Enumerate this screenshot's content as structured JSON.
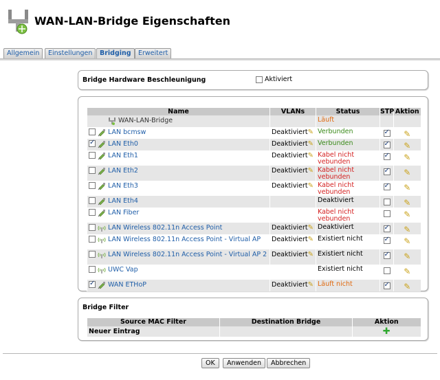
{
  "window": {
    "title": "WAN-LAN-Bridge Eigenschaften",
    "icon": "network-bridge-icon"
  },
  "tabs": [
    {
      "label": "Allgemein",
      "active": false
    },
    {
      "label": "Einstellungen",
      "active": false
    },
    {
      "label": "Bridging",
      "active": true
    },
    {
      "label": "Erweitert",
      "active": false
    }
  ],
  "hw_panel": {
    "title": "Bridge Hardware Beschleunigung",
    "checkbox_label": "Aktiviert",
    "checked": false
  },
  "table": {
    "headers": {
      "name": "Name",
      "vlans": "VLANs",
      "status": "Status",
      "stp": "STP",
      "action": "Aktion"
    },
    "bridge": {
      "name": "WAN-LAN-Bridge",
      "status": "Läuft"
    },
    "rows": [
      {
        "name": "LAN bcmsw",
        "icon": "ethernet-icon",
        "selected": false,
        "vlan": "Deaktiviert",
        "status": "Verbunden",
        "status_color": "green",
        "stp": true
      },
      {
        "name": "LAN Eth0",
        "icon": "ethernet-icon",
        "selected": true,
        "vlan": "Deaktiviert",
        "status": "Verbunden",
        "status_color": "green",
        "stp": true
      },
      {
        "name": "LAN Eth1",
        "icon": "ethernet-icon",
        "selected": false,
        "vlan": "Deaktiviert",
        "status": "Kabel nicht vebunden",
        "status_color": "red",
        "stp": true
      },
      {
        "name": "LAN Eth2",
        "icon": "ethernet-icon",
        "selected": false,
        "vlan": "Deaktiviert",
        "status": "Kabel nicht vebunden",
        "status_color": "red",
        "stp": true
      },
      {
        "name": "LAN Eth3",
        "icon": "ethernet-icon",
        "selected": false,
        "vlan": "Deaktiviert",
        "status": "Kabel nicht vebunden",
        "status_color": "red",
        "stp": true
      },
      {
        "name": "LAN Eth4",
        "icon": "ethernet-icon",
        "selected": false,
        "vlan": "",
        "status": "Deaktiviert",
        "status_color": "black",
        "stp": false
      },
      {
        "name": "LAN Fiber",
        "icon": "ethernet-icon",
        "selected": false,
        "vlan": "",
        "status": "Kabel nicht vebunden",
        "status_color": "red",
        "stp": false
      },
      {
        "name": "LAN Wireless 802.11n Access Point",
        "icon": "wireless-icon",
        "selected": false,
        "vlan": "Deaktiviert",
        "status": "Deaktiviert",
        "status_color": "black",
        "stp": true
      },
      {
        "name": "LAN Wireless 802.11n Access Point - Virtual AP",
        "icon": "wireless-icon",
        "selected": false,
        "vlan": "Deaktiviert",
        "status": "Existiert nicht",
        "status_color": "black",
        "stp": true
      },
      {
        "name": "LAN Wireless 802.11n Access Point - Virtual AP 2",
        "icon": "wireless-icon",
        "selected": false,
        "vlan": "Deaktiviert",
        "status": "Existiert nicht",
        "status_color": "black",
        "stp": true
      },
      {
        "name": "UWC Vap",
        "icon": "wireless-icon",
        "selected": false,
        "vlan": "",
        "status": "Existiert nicht",
        "status_color": "black",
        "stp": false
      },
      {
        "name": "WAN ETHoP",
        "icon": "ethernet-icon",
        "selected": true,
        "vlan": "Deaktiviert",
        "status": "Läuft nicht",
        "status_color": "orange",
        "stp": true
      }
    ]
  },
  "filter_panel": {
    "title": "Bridge Filter",
    "headers": {
      "source": "Source MAC Filter",
      "destination": "Destination Bridge",
      "action": "Aktion"
    },
    "new_entry": "Neuer Eintrag"
  },
  "buttons": {
    "ok": "OK",
    "apply": "Anwenden",
    "cancel": "Abbrechen"
  }
}
